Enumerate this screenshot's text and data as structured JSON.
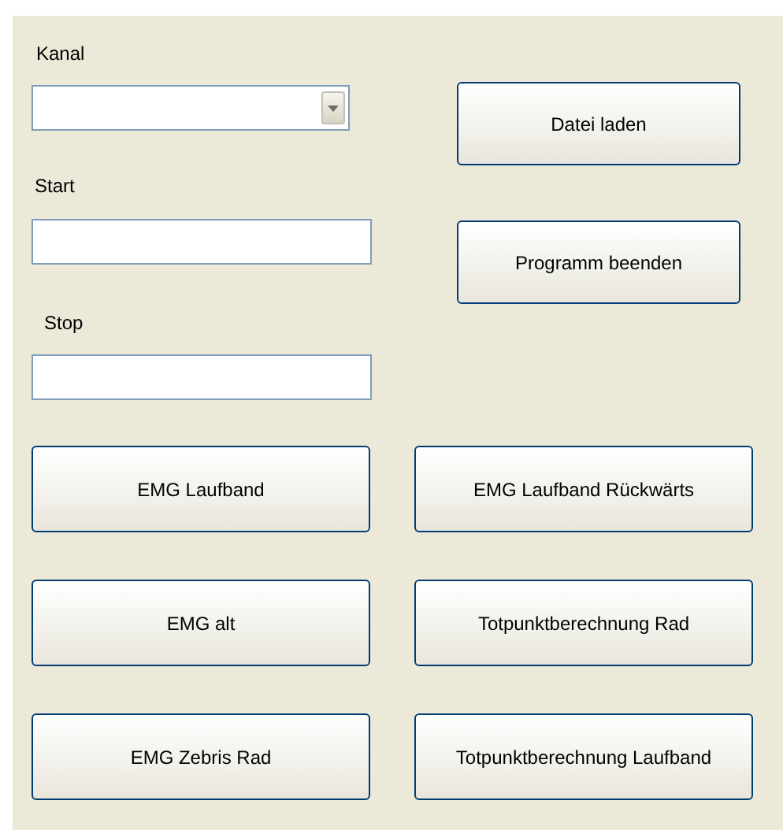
{
  "fields": [
    {
      "label": "Kanal",
      "kind": "dropdown"
    },
    {
      "label": "Start",
      "kind": "textbox"
    },
    {
      "label": "Stop",
      "kind": "textbox"
    }
  ],
  "side_buttons": [
    "Datei laden",
    "Programm beenden"
  ],
  "buttons": [
    "EMG Laufband",
    "EMG Laufband Rückwärts",
    "EMG alt",
    "Totpunktberechnung Rad",
    "EMG Zebris Rad",
    "Totpunktberechnung Laufband"
  ]
}
